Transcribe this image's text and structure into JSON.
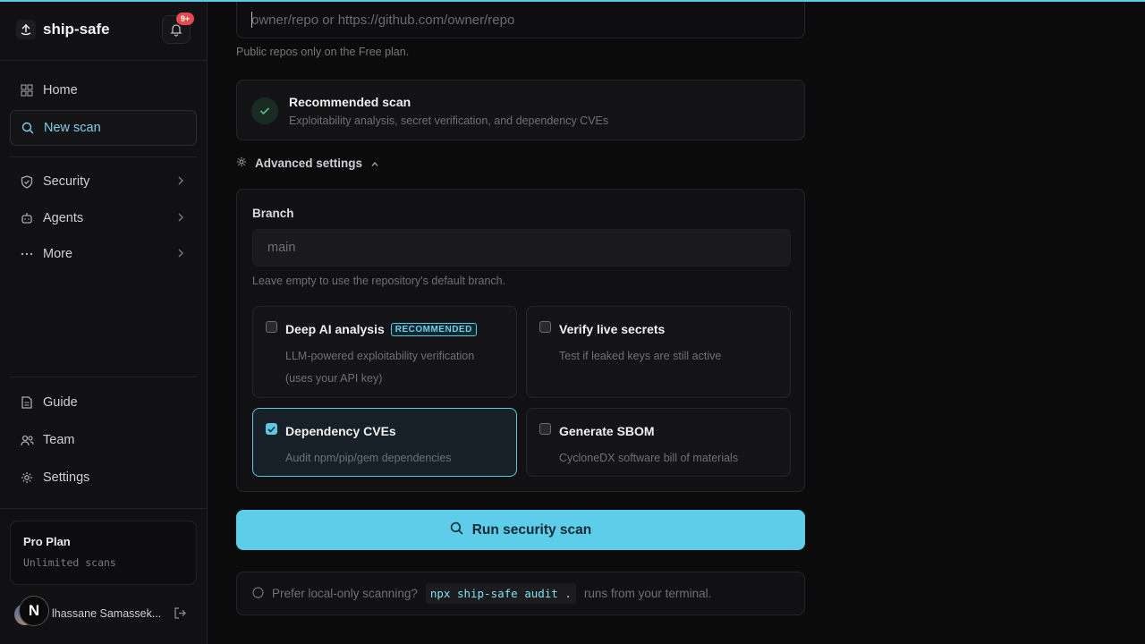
{
  "brand": {
    "name": "ship-safe"
  },
  "notifications": {
    "badge": "9+"
  },
  "sidebar": {
    "primary": [
      {
        "label": "Home",
        "icon": "grid-icon"
      },
      {
        "label": "New scan",
        "icon": "search-icon",
        "active": true
      }
    ],
    "groups": [
      {
        "label": "Security",
        "icon": "shield-icon"
      },
      {
        "label": "Agents",
        "icon": "bot-icon"
      },
      {
        "label": "More",
        "icon": "dots-icon"
      }
    ],
    "footer": [
      {
        "label": "Guide",
        "icon": "document-icon"
      },
      {
        "label": "Team",
        "icon": "users-icon"
      },
      {
        "label": "Settings",
        "icon": "gear-icon"
      }
    ]
  },
  "plan": {
    "title": "Pro Plan",
    "subtitle": "Unlimited scans"
  },
  "user": {
    "name": "lhassane Samassek...",
    "avatar_letter": "N"
  },
  "repo_input": {
    "placeholder": "owner/repo or https://github.com/owner/repo",
    "hint": "Public repos only on the Free plan."
  },
  "recommended": {
    "title": "Recommended scan",
    "description": "Exploitability analysis, secret verification, and dependency CVEs"
  },
  "advanced": {
    "toggle_label": "Advanced settings",
    "branch_label": "Branch",
    "branch_placeholder": "main",
    "branch_hint": "Leave empty to use the repository's default branch.",
    "options": [
      {
        "title": "Deep AI analysis",
        "badge": "RECOMMENDED",
        "description": "LLM-powered exploitability verification (uses your API key)",
        "checked": false
      },
      {
        "title": "Verify live secrets",
        "description": "Test if leaked keys are still active",
        "checked": false
      },
      {
        "title": "Dependency CVEs",
        "description": "Audit npm/pip/gem dependencies",
        "checked": true
      },
      {
        "title": "Generate SBOM",
        "description": "CycloneDX software bill of materials",
        "checked": false
      }
    ]
  },
  "run_button": {
    "label": "Run security scan"
  },
  "local_tip": {
    "prefix": "Prefer local-only scanning?",
    "command": "npx ship-safe audit .",
    "suffix": "runs from your terminal."
  },
  "colors": {
    "accent": "#5dcdea",
    "background": "#0b0b0c",
    "sidebar": "#111113",
    "badge": "#e5484d"
  }
}
